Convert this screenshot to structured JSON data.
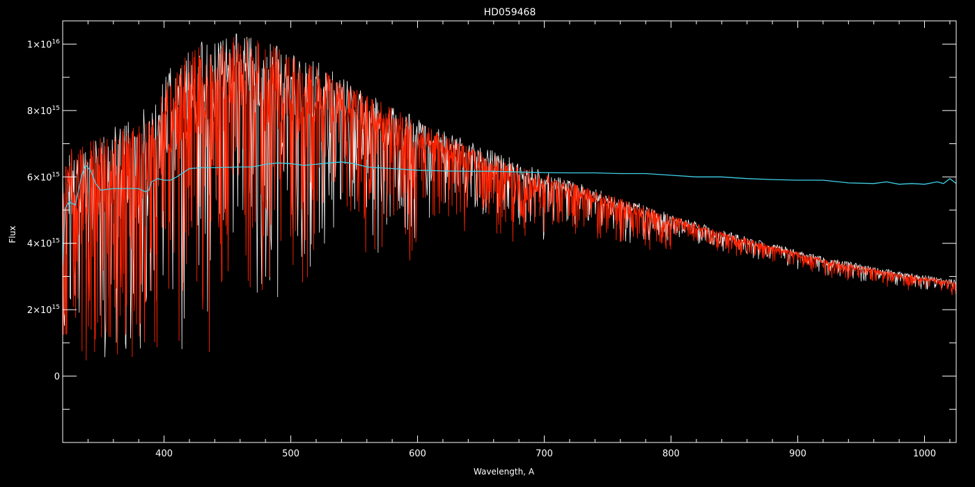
{
  "chart_data": {
    "type": "line",
    "title": "HD059468",
    "xlabel": "Wavelength, A",
    "ylabel": "Flux",
    "xlim": [
      320,
      1025
    ],
    "ylim": [
      -200000000000000.0,
      1070000000000000.0
    ],
    "x_ticks": [
      400,
      500,
      600,
      700,
      800,
      900,
      1000
    ],
    "y_ticks": [
      {
        "value": 0,
        "label": "0"
      },
      {
        "value": 200000000000000.0,
        "mantissa": "2",
        "times": "×10",
        "exp": "15"
      },
      {
        "value": 400000000000000.0,
        "mantissa": "4",
        "times": "×10",
        "exp": "15"
      },
      {
        "value": 600000000000000.0,
        "mantissa": "6",
        "times": "×10",
        "exp": "15"
      },
      {
        "value": 800000000000000.0,
        "mantissa": "8",
        "times": "×10",
        "exp": "15"
      },
      {
        "value": 1000000000000000.0,
        "mantissa": "1",
        "times": "×10",
        "exp": "16"
      }
    ],
    "grid": false,
    "series": [
      {
        "color": "#ffffff",
        "style": "spectrum",
        "x": [
          320,
          330,
          340,
          350,
          360,
          370,
          380,
          390,
          395,
          400,
          410,
          420,
          430,
          440,
          450,
          460,
          470,
          480,
          490,
          500,
          520,
          540,
          560,
          580,
          600,
          620,
          640,
          660,
          680,
          700,
          720,
          740,
          760,
          780,
          800,
          820,
          840,
          860,
          880,
          900,
          920,
          940,
          960,
          980,
          1000,
          1025
        ],
        "values": [
          650000000000000.0,
          700000000000000.0,
          720000000000000.0,
          740000000000000.0,
          760000000000000.0,
          790000000000000.0,
          800000000000000.0,
          810000000000000.0,
          830000000000000.0,
          900000000000000.0,
          960000000000000.0,
          1000000000000000.0,
          1010000000000000.0,
          1020000000000000.0,
          1040000000000000.0,
          1035000000000000.0,
          1030000000000000.0,
          1010000000000000.0,
          1000000000000000.0,
          980000000000000.0,
          950000000000000.0,
          900000000000000.0,
          860000000000000.0,
          820000000000000.0,
          775000000000000.0,
          740000000000000.0,
          710000000000000.0,
          680000000000000.0,
          650000000000000.0,
          620000000000000.0,
          590000000000000.0,
          565000000000000.0,
          540000000000000.0,
          515000000000000.0,
          490000000000000.0,
          465000000000000.0,
          440000000000000.0,
          420000000000000.0,
          400000000000000.0,
          380000000000000.0,
          360000000000000.0,
          345000000000000.0,
          330000000000000.0,
          315000000000000.0,
          305000000000000.0,
          290000000000000.0
        ]
      },
      {
        "color": "#ff2200",
        "style": "spectrum",
        "x": [
          320,
          330,
          340,
          350,
          360,
          370,
          380,
          390,
          395,
          400,
          410,
          420,
          430,
          440,
          450,
          460,
          470,
          480,
          490,
          500,
          520,
          540,
          560,
          580,
          600,
          620,
          640,
          660,
          680,
          700,
          720,
          740,
          760,
          780,
          800,
          820,
          840,
          860,
          880,
          900,
          920,
          940,
          960,
          980,
          1000,
          1025
        ],
        "values": [
          650000000000000.0,
          700000000000000.0,
          710000000000000.0,
          720000000000000.0,
          730000000000000.0,
          750000000000000.0,
          760000000000000.0,
          770000000000000.0,
          790000000000000.0,
          880000000000000.0,
          940000000000000.0,
          980000000000000.0,
          1000000000000000.0,
          1010000000000000.0,
          1030000000000000.0,
          1025000000000000.0,
          1020000000000000.0,
          1000000000000000.0,
          990000000000000.0,
          970000000000000.0,
          940000000000000.0,
          890000000000000.0,
          850000000000000.0,
          810000000000000.0,
          765000000000000.0,
          730000000000000.0,
          700000000000000.0,
          670000000000000.0,
          640000000000000.0,
          610000000000000.0,
          585000000000000.0,
          560000000000000.0,
          535000000000000.0,
          510000000000000.0,
          485000000000000.0,
          460000000000000.0,
          435000000000000.0,
          415000000000000.0,
          395000000000000.0,
          375000000000000.0,
          355000000000000.0,
          340000000000000.0,
          325000000000000.0,
          310000000000000.0,
          300000000000000.0,
          285000000000000.0
        ]
      },
      {
        "color": "#3fd2e8",
        "style": "line",
        "x": [
          320,
          322,
          325,
          330,
          335,
          338,
          342,
          346,
          350,
          360,
          370,
          380,
          385,
          388,
          390,
          395,
          400,
          405,
          410,
          420,
          430,
          440,
          460,
          470,
          480,
          490,
          500,
          510,
          520,
          530,
          540,
          550,
          560,
          580,
          600,
          620,
          640,
          660,
          680,
          700,
          720,
          740,
          760,
          780,
          800,
          820,
          840,
          860,
          880,
          900,
          920,
          940,
          960,
          970,
          980,
          990,
          1000,
          1010,
          1015,
          1020,
          1025
        ],
        "values": [
          330000000000000.0,
          505000000000000.0,
          525000000000000.0,
          515000000000000.0,
          605000000000000.0,
          635000000000000.0,
          620000000000000.0,
          580000000000000.0,
          560000000000000.0,
          565000000000000.0,
          565000000000000.0,
          565000000000000.0,
          555000000000000.0,
          560000000000000.0,
          585000000000000.0,
          595000000000000.0,
          590000000000000.0,
          590000000000000.0,
          600000000000000.0,
          625000000000000.0,
          628000000000000.0,
          628000000000000.0,
          630000000000000.0,
          630000000000000.0,
          638000000000000.0,
          642000000000000.0,
          640000000000000.0,
          635000000000000.0,
          638000000000000.0,
          642000000000000.0,
          645000000000000.0,
          640000000000000.0,
          630000000000000.0,
          625000000000000.0,
          620000000000000.0,
          618000000000000.0,
          617000000000000.0,
          617000000000000.0,
          615000000000000.0,
          613000000000000.0,
          612000000000000.0,
          612000000000000.0,
          610000000000000.0,
          610000000000000.0,
          605000000000000.0,
          600000000000000.0,
          600000000000000.0,
          595000000000000.0,
          592000000000000.0,
          590000000000000.0,
          590000000000000.0,
          582000000000000.0,
          580000000000000.0,
          585000000000000.0,
          578000000000000.0,
          580000000000000.0,
          578000000000000.0,
          585000000000000.0,
          580000000000000.0,
          595000000000000.0,
          580000000000000.0
        ]
      }
    ]
  }
}
